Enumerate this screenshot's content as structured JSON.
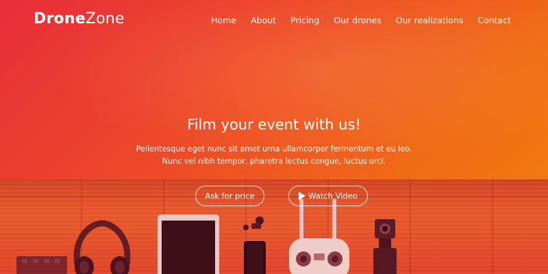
{
  "header": {
    "logo": {
      "bold": "Drone",
      "light": "Zone"
    },
    "nav": [
      {
        "label": "Home"
      },
      {
        "label": "About"
      },
      {
        "label": "Pricing"
      },
      {
        "label": "Our drones"
      },
      {
        "label": "Our realizations"
      },
      {
        "label": "Contact"
      }
    ]
  },
  "hero": {
    "title": "Film your event with us!",
    "lines": [
      "Pellentesque eget nunc sit amet urna ullamcorper fermentum et eu leo.",
      "Nunc vel nibh tempor, pharetra lectus congue, luctus orci."
    ],
    "buttons": {
      "price": "Ask for price",
      "video": "Watch Video"
    },
    "icons": {
      "play": "play-icon"
    }
  },
  "colors": {
    "gradient_start": "#e72e3b",
    "gradient_end": "#f3820a",
    "text": "#ffffff"
  }
}
